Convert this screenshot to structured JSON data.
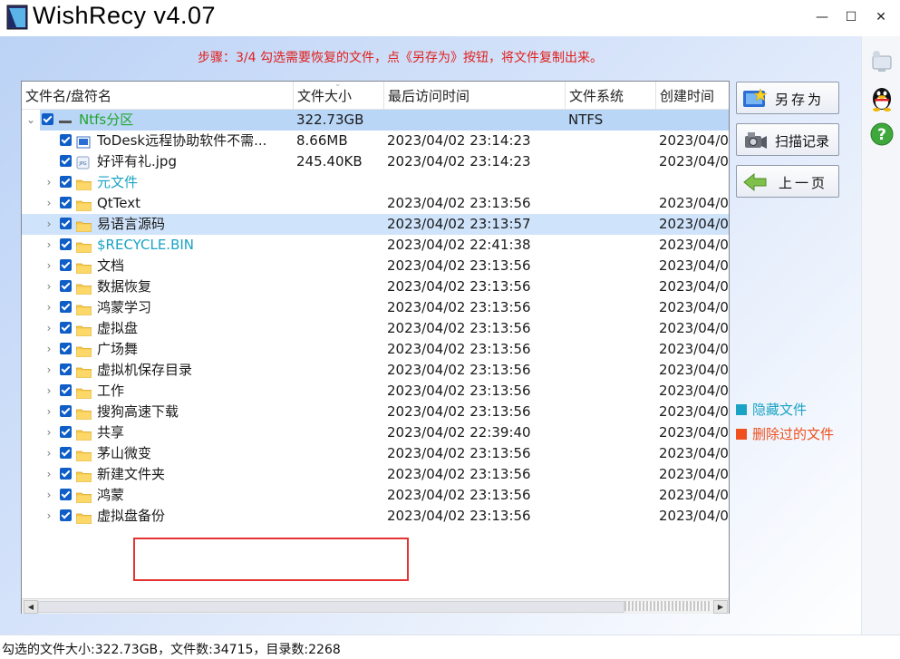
{
  "app": {
    "title": "WishRecy  v4.07",
    "instruction": "步骤：3/4 勾选需要恢复的文件，点《另存为》按钮，将文件复制出来。"
  },
  "columns": [
    "文件名/盘符名",
    "文件大小",
    "最后访问时间",
    "文件系统",
    "创建时间"
  ],
  "rows": [
    {
      "name": "Ntfs分区",
      "size": "322.73GB",
      "accessed": "",
      "fs": "NTFS",
      "created": "",
      "level": 0,
      "expand": "⌄",
      "icon": "drive-icon",
      "color": "#21a52e",
      "highlight": "root"
    },
    {
      "name": "ToDesk远程协助软件不需...",
      "size": "8.66MB",
      "accessed": "2023/04/02 23:14:23",
      "fs": "",
      "created": "2023/04/0",
      "level": 1,
      "expand": "",
      "icon": "app-file-icon",
      "color": "#1a1a1a",
      "highlight": ""
    },
    {
      "name": "好评有礼.jpg",
      "size": "245.40KB",
      "accessed": "2023/04/02 23:14:23",
      "fs": "",
      "created": "2023/04/0",
      "level": 1,
      "expand": "",
      "icon": "image-file-icon",
      "color": "#1a1a1a",
      "highlight": ""
    },
    {
      "name": "元文件",
      "size": "",
      "accessed": "",
      "fs": "",
      "created": "",
      "level": 1,
      "expand": "›",
      "icon": "folder-icon",
      "color": "#1aa3c4",
      "highlight": ""
    },
    {
      "name": "QtText",
      "size": "",
      "accessed": "2023/04/02 23:13:56",
      "fs": "",
      "created": "2023/04/0",
      "level": 1,
      "expand": "›",
      "icon": "folder-icon",
      "color": "#1a1a1a",
      "highlight": ""
    },
    {
      "name": "易语言源码",
      "size": "",
      "accessed": "2023/04/02 23:13:57",
      "fs": "",
      "created": "2023/04/0",
      "level": 1,
      "expand": "›",
      "icon": "folder-icon",
      "color": "#1a1a1a",
      "highlight": "sel"
    },
    {
      "name": "$RECYCLE.BIN",
      "size": "",
      "accessed": "2023/04/02 22:41:38",
      "fs": "",
      "created": "2023/04/0",
      "level": 1,
      "expand": "›",
      "icon": "folder-icon",
      "color": "#1aa3c4",
      "highlight": ""
    },
    {
      "name": "文档",
      "size": "",
      "accessed": "2023/04/02 23:13:56",
      "fs": "",
      "created": "2023/04/0",
      "level": 1,
      "expand": "›",
      "icon": "folder-icon",
      "color": "#1a1a1a",
      "highlight": ""
    },
    {
      "name": "数据恢复",
      "size": "",
      "accessed": "2023/04/02 23:13:56",
      "fs": "",
      "created": "2023/04/0",
      "level": 1,
      "expand": "›",
      "icon": "folder-icon",
      "color": "#1a1a1a",
      "highlight": ""
    },
    {
      "name": "鸿蒙学习",
      "size": "",
      "accessed": "2023/04/02 23:13:56",
      "fs": "",
      "created": "2023/04/0",
      "level": 1,
      "expand": "›",
      "icon": "folder-icon",
      "color": "#1a1a1a",
      "highlight": ""
    },
    {
      "name": "虚拟盘",
      "size": "",
      "accessed": "2023/04/02 23:13:56",
      "fs": "",
      "created": "2023/04/0",
      "level": 1,
      "expand": "›",
      "icon": "folder-icon",
      "color": "#1a1a1a",
      "highlight": ""
    },
    {
      "name": "广场舞",
      "size": "",
      "accessed": "2023/04/02 23:13:56",
      "fs": "",
      "created": "2023/04/0",
      "level": 1,
      "expand": "›",
      "icon": "folder-icon",
      "color": "#1a1a1a",
      "highlight": ""
    },
    {
      "name": "虚拟机保存目录",
      "size": "",
      "accessed": "2023/04/02 23:13:56",
      "fs": "",
      "created": "2023/04/0",
      "level": 1,
      "expand": "›",
      "icon": "folder-icon",
      "color": "#1a1a1a",
      "highlight": ""
    },
    {
      "name": "工作",
      "size": "",
      "accessed": "2023/04/02 23:13:56",
      "fs": "",
      "created": "2023/04/0",
      "level": 1,
      "expand": "›",
      "icon": "folder-icon",
      "color": "#1a1a1a",
      "highlight": ""
    },
    {
      "name": "搜狗高速下载",
      "size": "",
      "accessed": "2023/04/02 23:13:56",
      "fs": "",
      "created": "2023/04/0",
      "level": 1,
      "expand": "›",
      "icon": "folder-icon",
      "color": "#1a1a1a",
      "highlight": ""
    },
    {
      "name": "共享",
      "size": "",
      "accessed": "2023/04/02 22:39:40",
      "fs": "",
      "created": "2023/04/0",
      "level": 1,
      "expand": "›",
      "icon": "folder-icon",
      "color": "#1a1a1a",
      "highlight": ""
    },
    {
      "name": "茅山微变",
      "size": "",
      "accessed": "2023/04/02 23:13:56",
      "fs": "",
      "created": "2023/04/0",
      "level": 1,
      "expand": "›",
      "icon": "folder-icon",
      "color": "#1a1a1a",
      "highlight": ""
    },
    {
      "name": "新建文件夹",
      "size": "",
      "accessed": "2023/04/02 23:13:56",
      "fs": "",
      "created": "2023/04/0",
      "level": 1,
      "expand": "›",
      "icon": "folder-icon",
      "color": "#1a1a1a",
      "highlight": ""
    },
    {
      "name": "鸿蒙",
      "size": "",
      "accessed": "2023/04/02 23:13:56",
      "fs": "",
      "created": "2023/04/0",
      "level": 1,
      "expand": "›",
      "icon": "folder-icon",
      "color": "#1a1a1a",
      "highlight": ""
    },
    {
      "name": "虚拟盘备份",
      "size": "",
      "accessed": "2023/04/02 23:13:56",
      "fs": "",
      "created": "2023/04/0",
      "level": 1,
      "expand": "›",
      "icon": "folder-icon",
      "color": "#1a1a1a",
      "highlight": ""
    }
  ],
  "buttons": {
    "save_as": "另存为",
    "scan_record": "扫描记录",
    "prev_page": "上一页"
  },
  "legend": {
    "hidden": {
      "label": "隐藏文件",
      "color": "#1aa3c4"
    },
    "deleted": {
      "label": "删除过的文件",
      "color": "#f0501e"
    }
  },
  "status": "勾选的文件大小:322.73GB，文件数:34715，目录数:2268"
}
